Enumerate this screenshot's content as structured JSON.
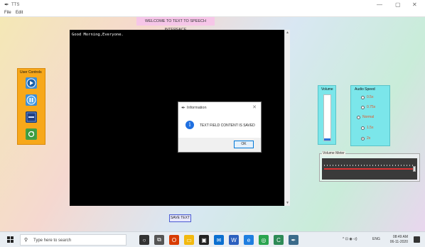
{
  "window": {
    "title": "TTS",
    "controls": {
      "minimize": "—",
      "maximize": "▢",
      "close": "✕"
    }
  },
  "menu": [
    {
      "label": "File"
    },
    {
      "label": "Edit"
    }
  ],
  "heading": "WELCOME TO TEXT TO SPEECH INTERFACE",
  "editor": {
    "text": "Good Morning,Everyone."
  },
  "save_button": "SAVE TEXT",
  "user_controls": {
    "label": "User Controls",
    "buttons": [
      {
        "icon": "play-icon"
      },
      {
        "icon": "pause-icon"
      },
      {
        "icon": "stop-icon"
      },
      {
        "icon": "refresh-icon"
      }
    ]
  },
  "volume": {
    "label": "Volume",
    "level": 0.04
  },
  "audio_speed": {
    "label": "Audio Speed",
    "options": [
      "0.5x",
      "0.75x",
      "Normal",
      "1.5x",
      "2x"
    ],
    "selected": "2x"
  },
  "volume_meter": {
    "label": "Volume Meter"
  },
  "dialog": {
    "title": "Information",
    "message": "TEXT FIELD CONTENT IS SAVED",
    "ok": "OK",
    "icon": "info-icon"
  },
  "taskbar": {
    "search_placeholder": "Type here to search",
    "apps": [
      {
        "icon": "cortana-icon",
        "color": "#333333"
      },
      {
        "icon": "task-view-icon",
        "color": "#555555"
      },
      {
        "icon": "office-icon",
        "color": "#d83b01"
      },
      {
        "icon": "file-explorer-icon",
        "color": "#f2b90f"
      },
      {
        "icon": "store-icon",
        "color": "#222222"
      },
      {
        "icon": "mail-icon",
        "color": "#0b6fd0"
      },
      {
        "icon": "word-icon",
        "color": "#2b5fbf"
      },
      {
        "icon": "edge-icon",
        "color": "#1f7ee0"
      },
      {
        "icon": "chrome-icon",
        "color": "#2aa44f"
      },
      {
        "icon": "ccleaner-icon",
        "color": "#2e8b57"
      },
      {
        "icon": "tts-app-icon",
        "color": "#3b6b8a"
      }
    ],
    "tray_language": "ENG",
    "time": "08:49 AM",
    "date": "06-11-2020"
  }
}
